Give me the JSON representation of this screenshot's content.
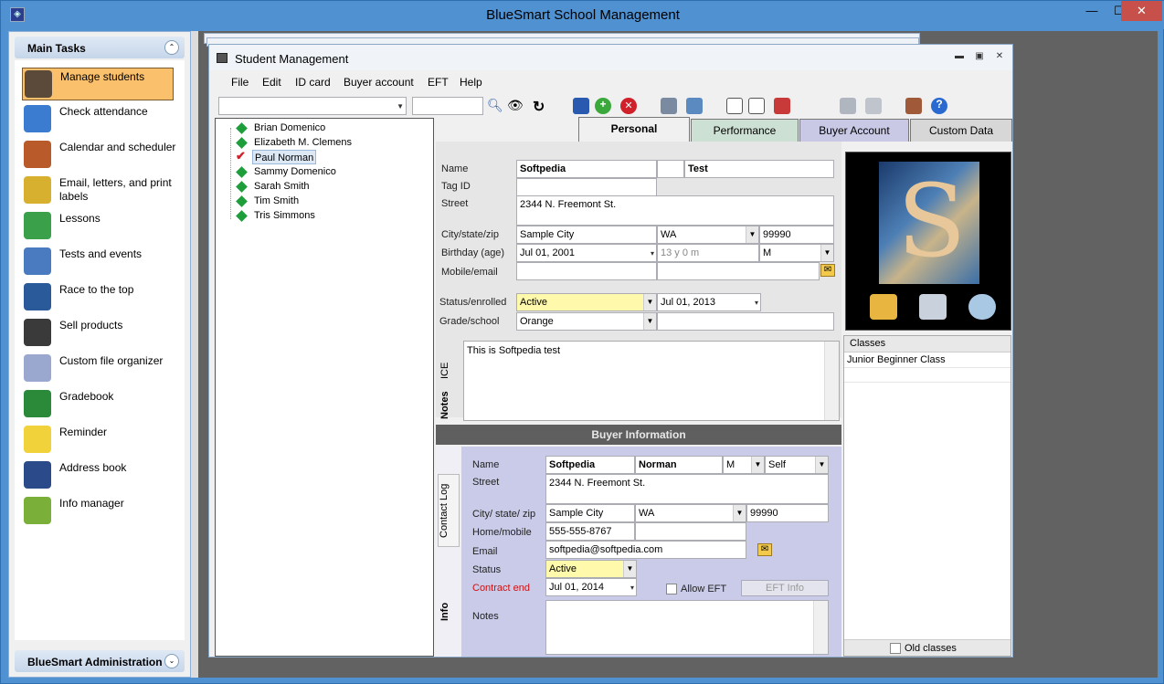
{
  "app": {
    "title": "BlueSmart School Management",
    "min": "—",
    "max": "☐",
    "close": "✕"
  },
  "left": {
    "main_tasks": "Main Tasks",
    "admin": "BlueSmart Administration",
    "tasks": [
      {
        "label": "Manage students",
        "icon": "student-icon",
        "color": "#5b4a3a"
      },
      {
        "label": "Check attendance",
        "icon": "attendance-icon",
        "color": "#3b7bd0"
      },
      {
        "label": "Calendar and scheduler",
        "icon": "calendar-icon",
        "color": "#b85a2a"
      },
      {
        "label": "Email, letters, and print labels",
        "icon": "email-icon",
        "color": "#d8b030"
      },
      {
        "label": "Lessons",
        "icon": "lessons-icon",
        "color": "#3aa04a"
      },
      {
        "label": "Tests and events",
        "icon": "tests-icon",
        "color": "#4a7ac0"
      },
      {
        "label": "Race to the top",
        "icon": "speedometer-icon",
        "color": "#2a5a9a"
      },
      {
        "label": "Sell products",
        "icon": "cart-icon",
        "color": "#3a3a3a"
      },
      {
        "label": "Custom file organizer",
        "icon": "cabinet-icon",
        "color": "#9aa8d0"
      },
      {
        "label": "Gradebook",
        "icon": "gradebook-icon",
        "color": "#2a8a3a"
      },
      {
        "label": "Reminder",
        "icon": "bulb-icon",
        "color": "#f2d23a"
      },
      {
        "label": "Address book",
        "icon": "addressbook-icon",
        "color": "#2a4a8a"
      },
      {
        "label": "Info manager",
        "icon": "info-icon",
        "color": "#7ab03a"
      }
    ]
  },
  "student_window": {
    "title": "Student Management",
    "menu": [
      "File",
      "Edit",
      "ID card",
      "Buyer account",
      "EFT",
      "Help"
    ],
    "students": [
      "Brian Domenico",
      "Elizabeth M. Clemens",
      "Paul Norman",
      "Sammy Domenico",
      "Sarah Smith",
      "Tim Smith",
      "Tris Simmons"
    ],
    "selected_student": "Paul Norman",
    "tabs": [
      "Personal",
      "Performance",
      "Buyer Account",
      "Custom Data"
    ],
    "active_tab": "Personal"
  },
  "personal": {
    "name_label": "Name",
    "first": "Softpedia",
    "last": "Test",
    "tagid_label": "Tag ID",
    "street_label": "Street",
    "street": "2344 N. Freemont St.",
    "city_label": "City/state/zip",
    "city": "Sample City",
    "state": "WA",
    "zip": "99990",
    "birthday_label": "Birthday (age)",
    "birthday": "Jul  01, 2001",
    "age": "13 y 0 m",
    "gender": "M",
    "mobile_label": "Mobile/email",
    "status_label": "Status/enrolled",
    "status": "Active",
    "enrolled": "Jul  01, 2013",
    "grade_label": "Grade/school",
    "grade": "Orange",
    "notes": "This is Softpedia test",
    "notes_tab": "Notes",
    "ice_tab": "ICE"
  },
  "classes": {
    "header": "Classes",
    "items": [
      "Junior Beginner Class"
    ],
    "old_label": "Old classes"
  },
  "buyer": {
    "header": "Buyer Information",
    "contact_tab": "Contact Log",
    "info_tab": "Info",
    "name_label": "Name",
    "first": "Softpedia",
    "last": "Norman",
    "gender": "M",
    "relation": "Self",
    "street_label": "Street",
    "street": "2344 N. Freemont St.",
    "city_label": "City/ state/ zip",
    "city": "Sample City",
    "state": "WA",
    "zip": "99990",
    "home_label": "Home/mobile",
    "home": "555-555-8767",
    "email_label": "Email",
    "email": "softpedia@softpedia.com",
    "status_label": "Status",
    "status": "Active",
    "contract_label": "Contract end",
    "contract": "Jul  01, 2014",
    "allow_eft": "Allow EFT",
    "eft_info": "EFT Info",
    "notes_label": "Notes"
  }
}
